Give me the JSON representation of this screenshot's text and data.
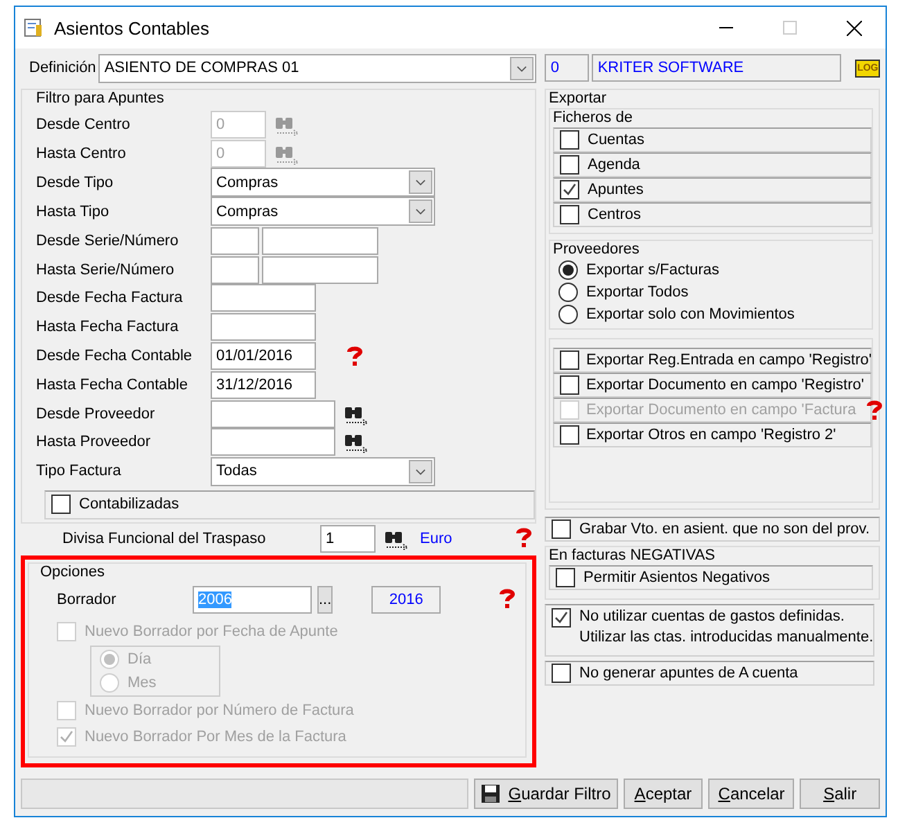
{
  "window": {
    "title": "Asientos Contables"
  },
  "definition": {
    "label": "Definición",
    "value": "ASIENTO DE COMPRAS 01",
    "code": "0",
    "company": "KRITER SOFTWARE",
    "log_label": "LOG"
  },
  "filter": {
    "title": "Filtro para Apuntes",
    "rows": [
      {
        "kind": "code",
        "label": "Desde Centro",
        "value": "0",
        "disabled": true
      },
      {
        "kind": "code",
        "label": "Hasta Centro",
        "value": "0",
        "disabled": true
      },
      {
        "kind": "select",
        "label": "Desde Tipo",
        "value": "Compras"
      },
      {
        "kind": "select",
        "label": "Hasta Tipo",
        "value": "Compras"
      },
      {
        "kind": "pair",
        "label": "Desde Serie/Número"
      },
      {
        "kind": "pair",
        "label": "Hasta Serie/Número"
      },
      {
        "kind": "date",
        "label": "Desde Fecha Factura"
      },
      {
        "kind": "date",
        "label": "Hasta Fecha Factura"
      },
      {
        "kind": "date",
        "label": "Desde Fecha Contable",
        "value": "01/01/2016",
        "help": true
      },
      {
        "kind": "date",
        "label": "Hasta Fecha Contable",
        "value": "31/12/2016"
      },
      {
        "kind": "search",
        "label": "Desde Proveedor"
      },
      {
        "kind": "search",
        "label": "Hasta Proveedor"
      },
      {
        "kind": "select",
        "label": "Tipo Factura",
        "value": "Todas"
      }
    ],
    "contabilizadas": {
      "label": "Contabilizadas",
      "checked": false
    }
  },
  "currency": {
    "label": "Divisa Funcional del Traspaso",
    "value": "1",
    "name": "Euro"
  },
  "options": {
    "title": "Opciones",
    "highlighted": true,
    "borrador_label": "Borrador",
    "borrador_value": "2006",
    "browse": "...",
    "year": "2016",
    "items": [
      {
        "kind": "check",
        "label": "Nuevo Borrador por Fecha de Apunte",
        "checked": false,
        "disabled": true
      },
      {
        "kind": "radios",
        "radios": [
          {
            "label": "Día",
            "selected": true
          },
          {
            "label": "Mes",
            "selected": false
          }
        ],
        "disabled": true
      },
      {
        "kind": "check",
        "label": "Nuevo Borrador por Número de Factura",
        "checked": false,
        "disabled": true
      },
      {
        "kind": "check",
        "label": "Nuevo Borrador Por Mes de la Factura",
        "checked": true,
        "disabled": true
      }
    ]
  },
  "export": {
    "title": "Exportar",
    "files_title": "Ficheros de",
    "files": [
      {
        "label": "Cuentas",
        "checked": false
      },
      {
        "label": "Agenda",
        "checked": false
      },
      {
        "label": "Apuntes",
        "checked": true
      },
      {
        "label": "Centros",
        "checked": false
      }
    ],
    "suppliers_title": "Proveedores",
    "suppliers": [
      {
        "label": "Exportar s/Facturas",
        "selected": true
      },
      {
        "label": "Exportar Todos",
        "selected": false
      },
      {
        "label": "Exportar solo con Movimientos",
        "selected": false
      }
    ],
    "registro": [
      {
        "label": "Exportar Reg.Entrada en campo 'Registro'",
        "checked": false,
        "disabled": false
      },
      {
        "label": "Exportar Documento en campo 'Registro'",
        "checked": false,
        "disabled": false
      },
      {
        "label": "Exportar Documento en campo 'Factura",
        "checked": false,
        "disabled": true,
        "help": true
      },
      {
        "label": "Exportar Otros en campo 'Registro 2'",
        "checked": false,
        "disabled": false
      }
    ]
  },
  "grabar": {
    "label": "Grabar Vto. en asient. que no son del prov.",
    "checked": false
  },
  "negativas": {
    "title": "En facturas NEGATIVAS",
    "label": "Permitir Asientos Negativos",
    "checked": false
  },
  "gastos": {
    "lines": [
      "No utilizar cuentas de gastos definidas.",
      "Utilizar las ctas. introducidas manualmente."
    ],
    "checked": true
  },
  "anticipos": {
    "label": "No generar apuntes de A cuenta",
    "checked": false
  },
  "buttons": [
    {
      "label": "Guardar Filtro"
    },
    {
      "label": "Aceptar"
    },
    {
      "label": "Cancelar"
    },
    {
      "label": "Salir"
    }
  ]
}
